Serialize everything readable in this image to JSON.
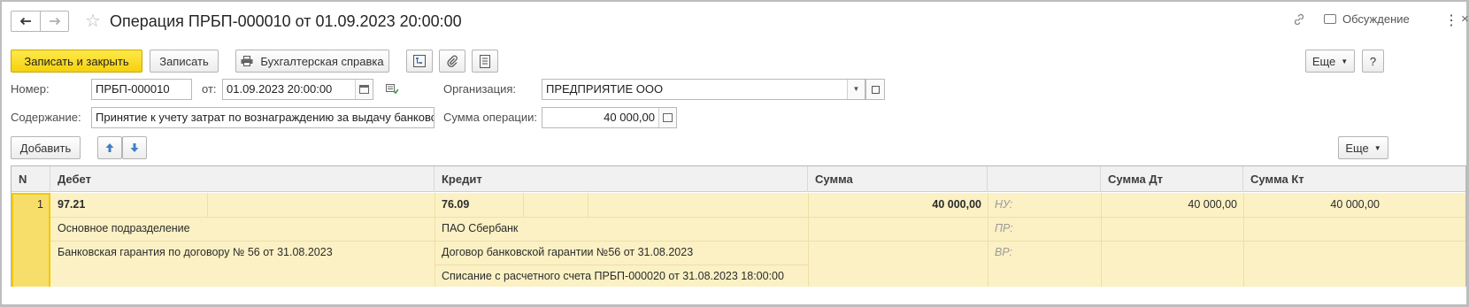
{
  "window": {
    "title": "Операция ПРБП-000010 от 01.09.2023 20:00:00",
    "discussion_label": "Обсуждение"
  },
  "nav": {
    "back_icon": "arrow-left-icon",
    "forward_icon": "arrow-right-icon"
  },
  "toolbar": {
    "save_close": "Записать и закрыть",
    "save": "Записать",
    "print_ref": "Бухгалтерская справка",
    "more": "Еще",
    "help": "?"
  },
  "form": {
    "number_label": "Номер:",
    "number_value": "ПРБП-000010",
    "date_label": "от:",
    "date_value": "01.09.2023 20:00:00",
    "org_label": "Организация:",
    "org_value": "ПРЕДПРИЯТИЕ ООО",
    "content_label": "Содержание:",
    "content_value": "Принятие к учету затрат по вознаграждению за выдачу банковской гарантии",
    "sum_label": "Сумма операции:",
    "sum_value": "40 000,00"
  },
  "table_toolbar": {
    "add": "Добавить",
    "more": "Еще"
  },
  "table": {
    "columns": [
      "N",
      "Дебет",
      "Кредит",
      "Сумма",
      "",
      "Сумма Дт",
      "Сумма Кт"
    ],
    "rows": [
      {
        "n": "1",
        "debit_account": "97.21",
        "debit_sub1": "Основное подразделение",
        "debit_sub2": "Банковская гарантия по договору № 56 от 31.08.2023",
        "credit_account": "76.09",
        "credit_sub1": "ПАО Сбербанк",
        "credit_sub2": "Договор банковской гарантии №56 от 31.08.2023",
        "credit_sub3": "Списание с расчетного счета ПРБП-000020 от 31.08.2023 18:00:00",
        "sum": "40 000,00",
        "nu": "НУ:",
        "pr": "ПР:",
        "vr": "ВР:",
        "sum_dt": "40 000,00",
        "sum_kt": "40 000,00"
      }
    ]
  }
}
